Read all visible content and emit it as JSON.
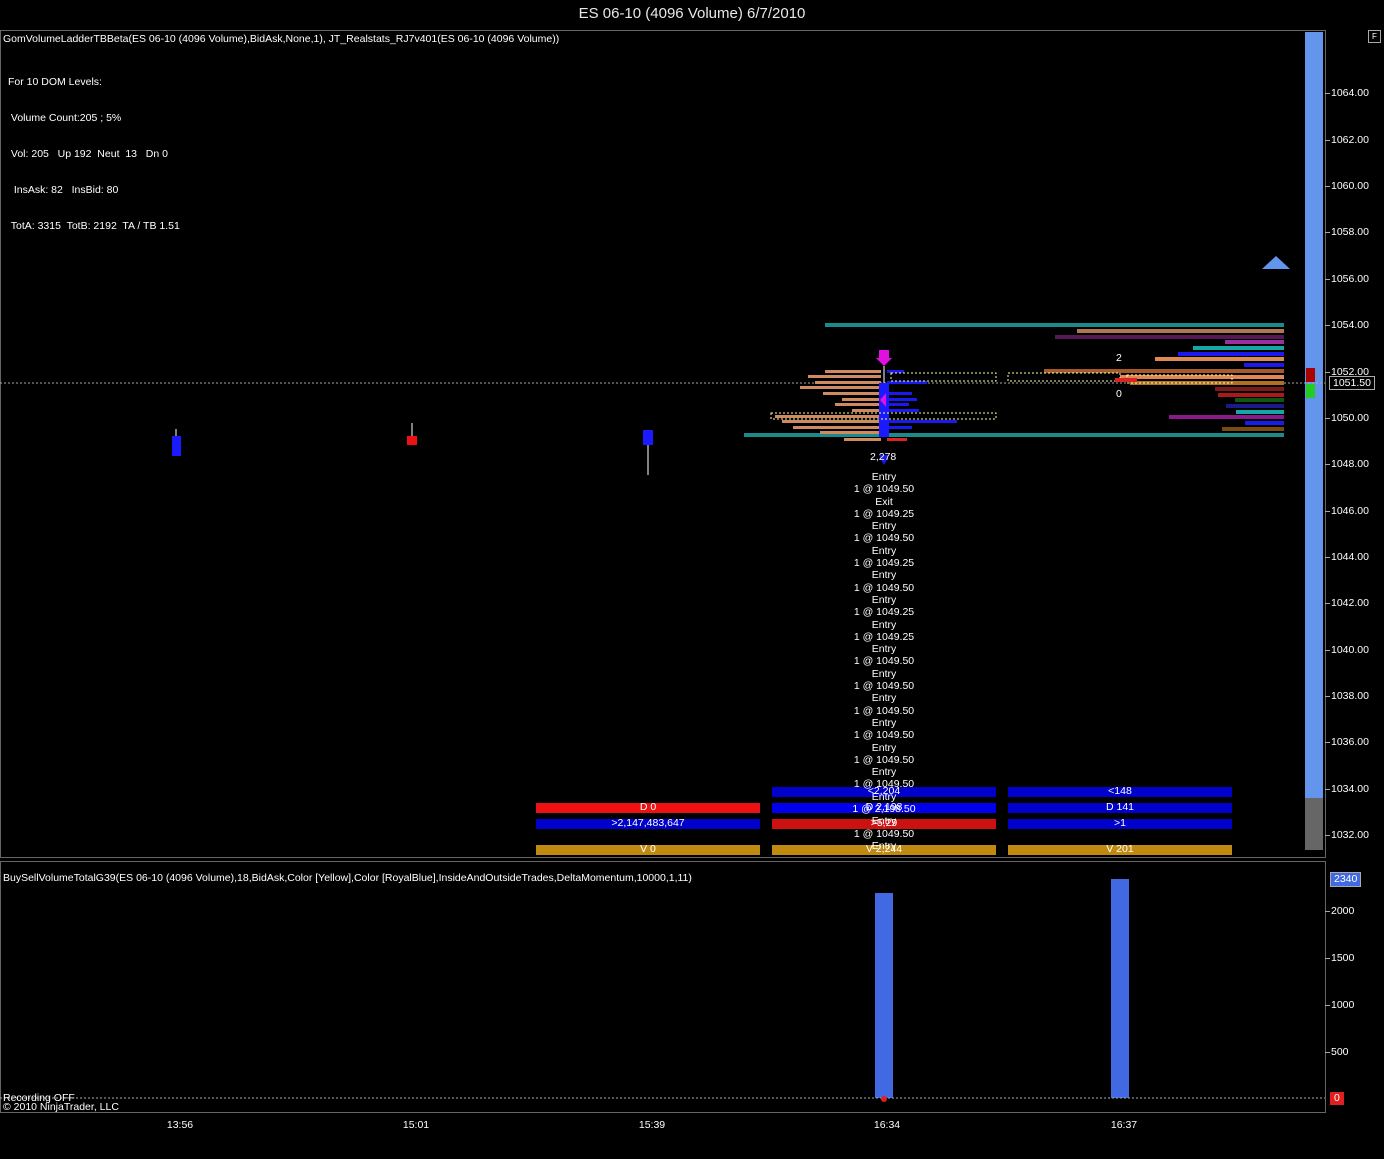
{
  "window": {
    "title": "ES 06-10 (4096 Volume)  6/7/2010",
    "corner_button": "F"
  },
  "price_panel": {
    "indicator_label": "GomVolumeLadderTBBeta(ES 06-10 (4096 Volume),BidAsk,None,1), JT_Realstats_RJ7v401(ES 06-10 (4096 Volume))",
    "stats": {
      "line1": "For 10 DOM Levels:",
      "line2": " Volume Count:205 ; 5%",
      "line3": " Vol: 205   Up 192  Neut  13   Dn 0",
      "line4": "  InsAsk: 82   InsBid: 80",
      "line5": " TotA: 3315  TotB: 2192  TA / TB 1.51"
    },
    "price_axis": [
      "1064.00",
      "1062.00",
      "1060.00",
      "1058.00",
      "1056.00",
      "1054.00",
      "1052.00",
      "1050.00",
      "1048.00",
      "1046.00",
      "1044.00",
      "1042.00",
      "1040.00",
      "1038.00",
      "1036.00",
      "1034.00",
      "1032.00"
    ],
    "current_price": "1051.50",
    "trade_labels": {
      "volume_2278": "2,278",
      "count_2": "2",
      "count_0": "0",
      "list": [
        "Entry",
        "1 @ 1049.50",
        "Exit",
        "1 @ 1049.25",
        "Entry",
        "1 @ 1049.50",
        "Entry",
        "1 @ 1049.25",
        "Entry",
        "1 @ 1049.50",
        "Entry",
        "1 @ 1049.25",
        "Entry",
        "1 @ 1049.25",
        "Entry",
        "1 @ 1049.50",
        "Entry",
        "1 @ 1049.50",
        "Entry",
        "1 @ 1049.50",
        "Entry",
        "1 @ 1049.50",
        "Entry",
        "1 @ 1049.50",
        "Entry",
        "1 @ 1049.50",
        "Entry",
        "1 @ 2,198.50",
        "Entry",
        "1 @ 1049.50",
        "Entry"
      ]
    },
    "stat_bars": {
      "col1": {
        "d": "D 0",
        "vol": ">2,147,483,647",
        "v": "V 0"
      },
      "col2": {
        "top": "<2,204",
        "d": "D 2,198",
        "vol": ">5,29",
        "v": "V 2,244"
      },
      "col3": {
        "top": "<148",
        "d": "D 141",
        "vol": ">1",
        "v": "V 201"
      }
    },
    "colors": {
      "bid_bar": "#0000cc",
      "ask_bar": "#dd1111",
      "volume_bar": "#c08a10",
      "axis_bar": "#6495ed"
    }
  },
  "volume_panel": {
    "indicator_label": "BuySellVolumeTotalG39(ES 06-10 (4096 Volume),18,BidAsk,Color [Yellow],Color [RoyalBlue],InsideAndOutsideTrades,DeltaMomentum,10000,1,11)",
    "axis": [
      "2000",
      "1500",
      "1000",
      "500"
    ],
    "current_value": "2340",
    "zero_value": "0"
  },
  "time_axis": [
    "13:56",
    "15:01",
    "15:39",
    "16:34",
    "16:37"
  ],
  "footer": {
    "recording": "Recording OFF",
    "copyright": "© 2010 NinjaTrader, LLC"
  }
}
